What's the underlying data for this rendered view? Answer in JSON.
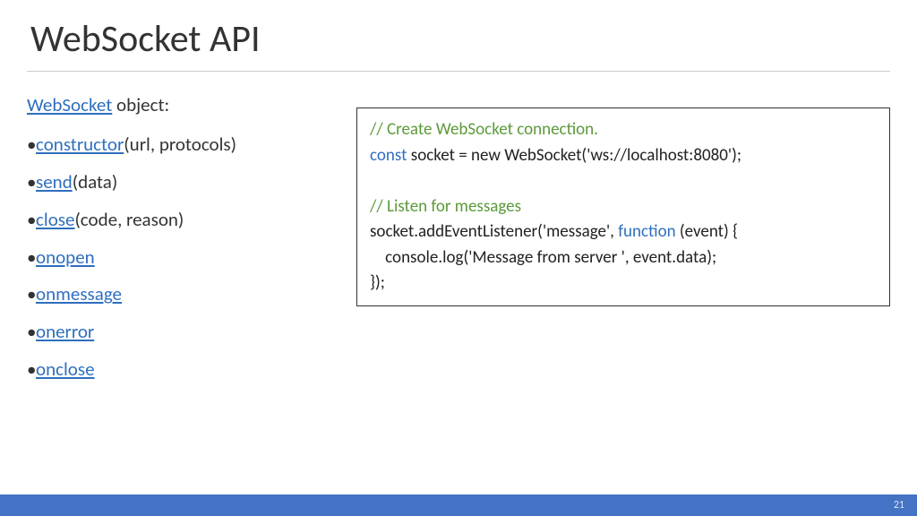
{
  "title": "WebSocket API",
  "object_link": "WebSocket",
  "object_suffix": " object:",
  "api_items": [
    {
      "link": "constructor",
      "params": "(url, protocols)"
    },
    {
      "link": "send",
      "params": "(data)"
    },
    {
      "link": "close",
      "params": "(code, reason)"
    },
    {
      "link": "onopen",
      "params": ""
    },
    {
      "link": "onmessage",
      "params": ""
    },
    {
      "link": "onerror",
      "params": ""
    },
    {
      "link": "onclose",
      "params": ""
    }
  ],
  "code": {
    "c1": "// Create WebSocket connection.",
    "kw1": "const",
    "l2": " socket = new WebSocket('ws://localhost:8080');",
    "blank": "",
    "c2": "// Listen for messages",
    "l4a": "socket.addEventListener('message', ",
    "kw2": "function",
    "l4b": " (event) {",
    "l5": "    console.log('Message from server ', event.data);",
    "l6": "});"
  },
  "page_number": "21"
}
